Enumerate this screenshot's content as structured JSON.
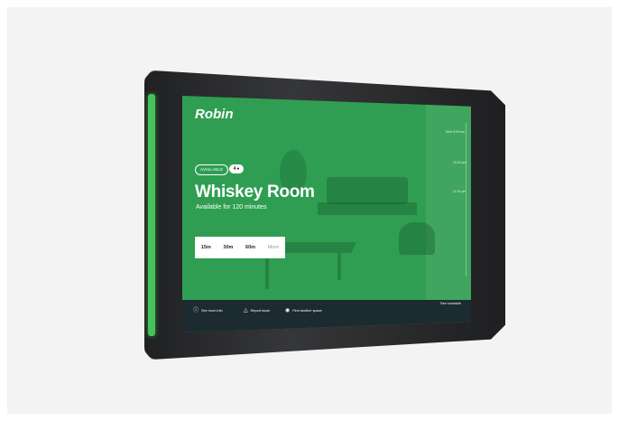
{
  "app": {
    "brand": "Robin"
  },
  "timeline": {
    "labels": [
      "Now 9:00 am",
      "10:00 pm",
      "11:00 pm"
    ]
  },
  "room": {
    "status": "AVAILABLE",
    "capacity": "4",
    "name": "Whiskey Room",
    "availability": "Available for 120 minutes"
  },
  "booking": {
    "options": [
      "15m",
      "30m",
      "60m"
    ],
    "more_label": "More"
  },
  "footer": {
    "room_info": "See room info",
    "report_issue": "Report issue",
    "find_space": "Find another space",
    "schedule": "See schedule"
  },
  "colors": {
    "screen_green": "#2f9e52",
    "led_green": "#46c15c",
    "footer_bg": "#1c2b30"
  }
}
